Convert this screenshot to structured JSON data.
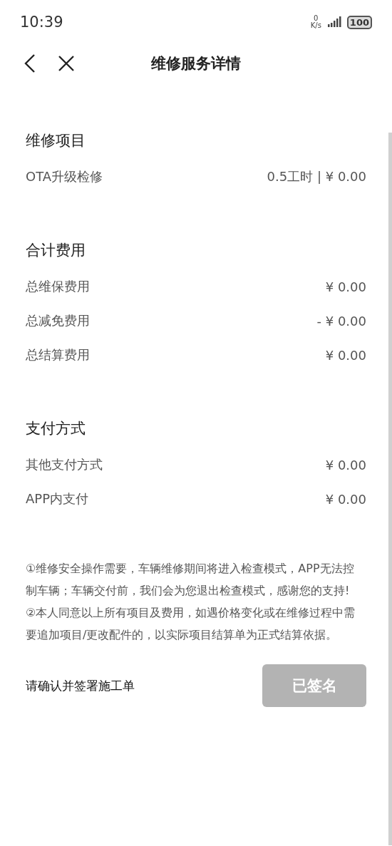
{
  "status_bar": {
    "time": "10:39",
    "speed_value": "0",
    "speed_unit": "K/s",
    "battery": "100"
  },
  "nav": {
    "title": "维修服务详情"
  },
  "sections": [
    {
      "title": "维修项目",
      "rows": [
        {
          "label": "OTA升级检修",
          "value": "0.5工时 | ¥ 0.00"
        }
      ]
    },
    {
      "title": "合计费用",
      "rows": [
        {
          "label": "总维保费用",
          "value": "¥ 0.00"
        },
        {
          "label": "总减免费用",
          "value": "- ¥ 0.00"
        },
        {
          "label": "总结算费用",
          "value": "¥ 0.00"
        }
      ]
    },
    {
      "title": "支付方式",
      "rows": [
        {
          "label": "其他支付方式",
          "value": "¥ 0.00"
        },
        {
          "label": "APP内支付",
          "value": "¥ 0.00"
        }
      ]
    }
  ],
  "notes": [
    "①维修安全操作需要，车辆维修期间将进入检查模式，APP无法控制车辆；车辆交付前，我们会为您退出检查模式，感谢您的支持!",
    "②本人同意以上所有项目及费用，如遇价格变化或在维修过程中需要追加项目/更改配件的，以实际项目结算单为正式结算依据。"
  ],
  "footer": {
    "prompt": "请确认并签署施工单",
    "button": {
      "label": "已签名",
      "disabled": true
    }
  }
}
